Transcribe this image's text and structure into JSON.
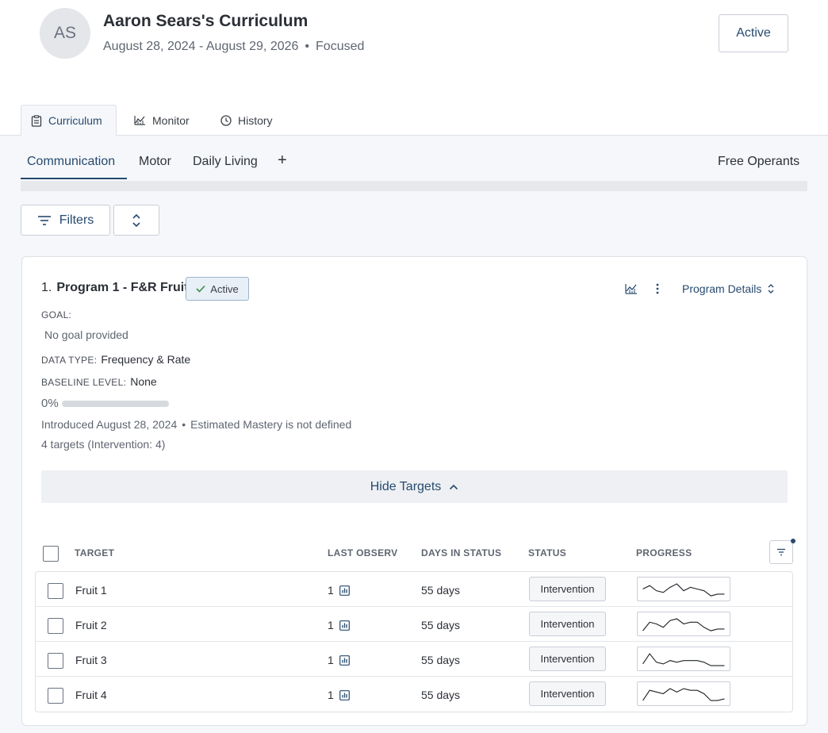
{
  "header": {
    "avatar_initials": "AS",
    "title": "Aaron Sears's Curriculum",
    "date_range": "August 28, 2024 - August 29, 2026",
    "separator": "•",
    "mode": "Focused",
    "status_button": "Active"
  },
  "top_tabs": [
    {
      "label": "Curriculum",
      "icon": "clipboard-icon",
      "active": true
    },
    {
      "label": "Monitor",
      "icon": "chart-icon",
      "active": false
    },
    {
      "label": "History",
      "icon": "clock-icon",
      "active": false
    }
  ],
  "domain_tabs": [
    {
      "label": "Communication",
      "active": true
    },
    {
      "label": "Motor",
      "active": false
    },
    {
      "label": "Daily Living",
      "active": false
    }
  ],
  "add_domain_label": "+",
  "free_operants_label": "Free Operants",
  "toolbar": {
    "filters_label": "Filters"
  },
  "program": {
    "number": "1.",
    "name": "Program 1 - F&R Fruit",
    "badge": "Active",
    "details_label": "Program Details",
    "goal_label": "GOAL:",
    "goal_value": "No goal provided",
    "data_type_label": "DATA TYPE:",
    "data_type_value": "Frequency & Rate",
    "baseline_label": "BASELINE LEVEL:",
    "baseline_value": "None",
    "progress_percent": "0%",
    "progress_fraction": 0,
    "introduced": "Introduced August 28, 2024",
    "separator": "•",
    "mastery": "Estimated Mastery is not defined",
    "targets_summary": "4 targets (Intervention: 4)",
    "hide_targets_label": "Hide Targets"
  },
  "table": {
    "columns": {
      "target": "TARGET",
      "last_observ": "LAST OBSERV",
      "days_in_status": "DAYS IN STATUS",
      "status": "STATUS",
      "progress": "PROGRESS"
    },
    "rows": [
      {
        "target": "Fruit 1",
        "last_observ": "1",
        "days": "55 days",
        "status": "Intervention",
        "spark": [
          5,
          3,
          6,
          7,
          4,
          2,
          6,
          4,
          5,
          6,
          9,
          8,
          8
        ]
      },
      {
        "target": "Fruit 2",
        "last_observ": "1",
        "days": "55 days",
        "status": "Intervention",
        "spark": [
          9,
          4,
          5,
          7,
          3,
          2,
          5,
          4,
          4,
          7,
          9,
          8,
          8
        ]
      },
      {
        "target": "Fruit 3",
        "last_observ": "1",
        "days": "55 days",
        "status": "Intervention",
        "spark": [
          8,
          2,
          7,
          8,
          6,
          7,
          6,
          6,
          6,
          7,
          9,
          9,
          9
        ]
      },
      {
        "target": "Fruit 4",
        "last_observ": "1",
        "days": "55 days",
        "status": "Intervention",
        "spark": [
          9,
          3,
          4,
          5,
          2,
          4,
          2,
          3,
          3,
          5,
          9,
          9,
          8
        ]
      }
    ]
  },
  "colors": {
    "accent": "#274a6e",
    "background": "#f5f7fa",
    "border": "#c9ced6"
  }
}
